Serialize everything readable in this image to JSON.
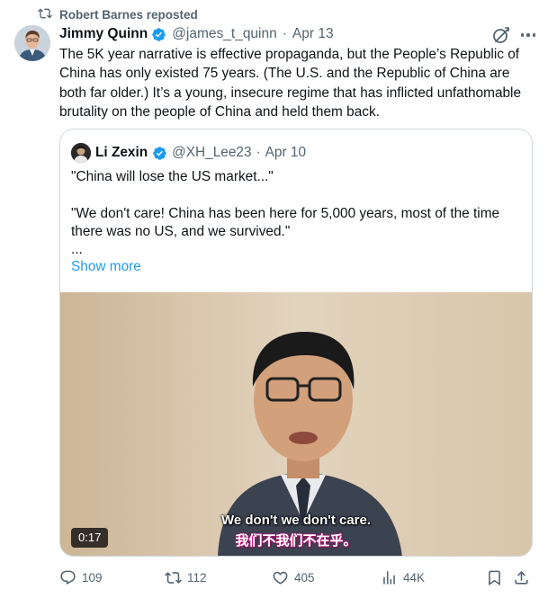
{
  "repost": {
    "text": "Robert Barnes reposted",
    "icon": "repost-icon"
  },
  "tweet": {
    "author_name": "Jimmy Quinn",
    "handle": "@james_t_quinn",
    "date": "Apr 13",
    "verified": true,
    "text": "The 5K year narrative is effective propaganda, but the People’s Republic of China has only existed 75 years. (The U.S. and the Republic of China are both far older.) It’s a young, insecure regime that has inflicted unfathomable brutality on the people of China and held them back."
  },
  "quote": {
    "author_name": "Li Zexin",
    "handle": "@XH_Lee23",
    "date": "Apr 10",
    "verified": true,
    "text": "\"China will lose the US market...\"\n\n\"We don't care! China has been here for 5,000 years, most of the time there was no US, and we survived.\"\n...",
    "show_more": "Show more",
    "video": {
      "duration": "0:17",
      "subtitle_en": "We don't we don't care.",
      "subtitle_zh": "我们不我们不在乎。"
    }
  },
  "actions": {
    "replies": "109",
    "reposts": "112",
    "likes": "405",
    "views": "44K"
  },
  "colors": {
    "accent": "#1d9bf0",
    "muted": "#536471",
    "text": "#0f1419",
    "border": "#cfd9de"
  }
}
